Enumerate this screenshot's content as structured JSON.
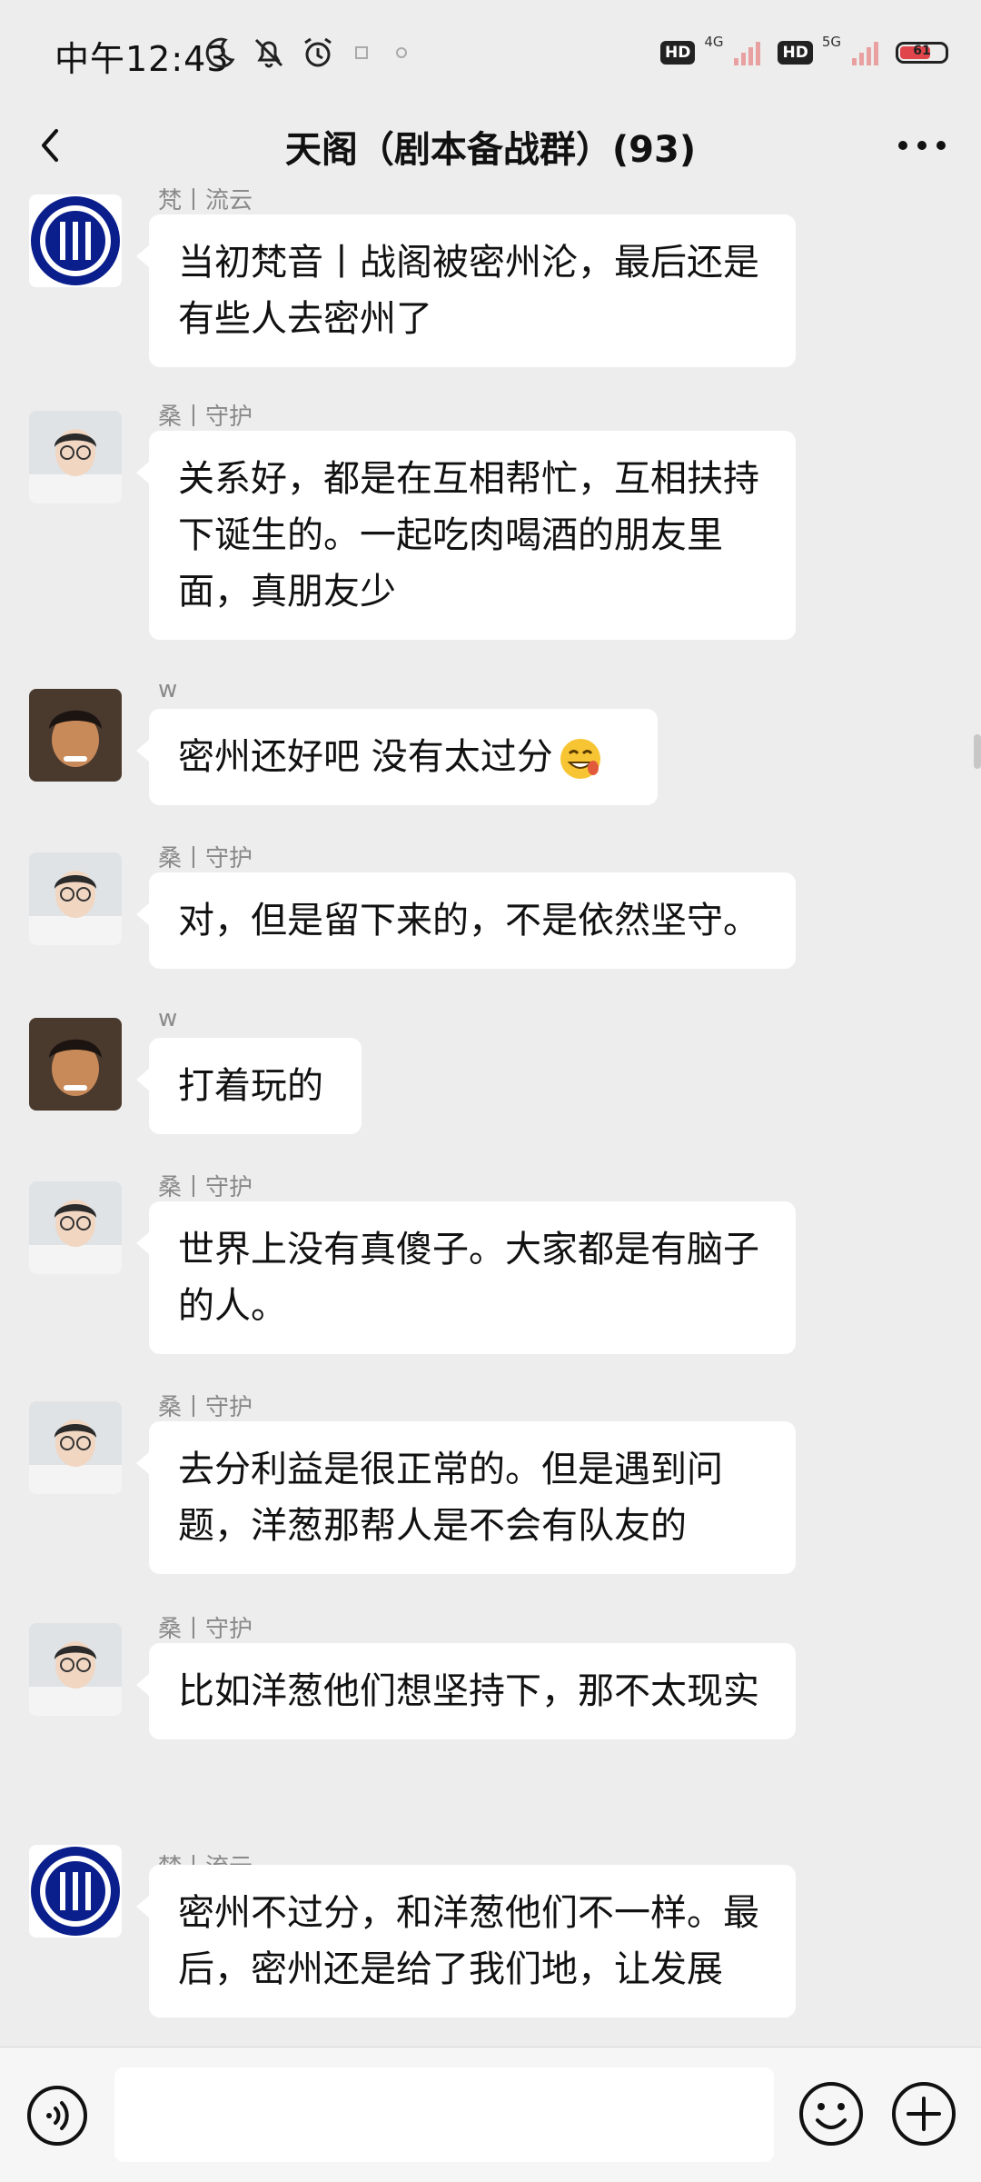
{
  "status_bar": {
    "time": "中午12:43",
    "hd_label": "HD",
    "net1": "4G",
    "net2": "5G",
    "battery": "61"
  },
  "header": {
    "title": "天阁（剧本备战群）(93)"
  },
  "messages": [
    {
      "sender": "梵丨流云",
      "avatar": "inter-logo",
      "text": "当初梵音丨战阁被密州沦，最后还是有些人去密州了"
    },
    {
      "sender": "桑丨守护",
      "avatar": "person-photo",
      "text": "关系好，都是在互相帮忙，互相扶持下诞生的。一起吃肉喝酒的朋友里面，真朋友少"
    },
    {
      "sender": "w",
      "avatar": "boy-photo",
      "text": "密州还好吧 没有太过分",
      "emoji": "grinning-sweat-emoji"
    },
    {
      "sender": "桑丨守护",
      "avatar": "person-photo",
      "text": "对，但是留下来的，不是依然坚守。"
    },
    {
      "sender": "w",
      "avatar": "boy-photo",
      "text": "打着玩的"
    },
    {
      "sender": "桑丨守护",
      "avatar": "person-photo",
      "text": "世界上没有真傻子。大家都是有脑子的人。"
    },
    {
      "sender": "桑丨守护",
      "avatar": "person-photo",
      "text": "去分利益是很正常的。但是遇到问题，洋葱那帮人是不会有队友的"
    },
    {
      "sender": "桑丨守护",
      "avatar": "person-photo",
      "text": "比如洋葱他们想坚持下，那不太现实"
    },
    {
      "sender": "梵丨流云",
      "avatar": "inter-logo",
      "text": "密州不过分，和洋葱他们不一样。最后，密州还是给了我们地，让发展"
    }
  ],
  "input": {
    "placeholder": ""
  },
  "colors": {
    "background": "#ededed",
    "bubble": "#ffffff",
    "inter_blue": "#0a1e8c"
  }
}
